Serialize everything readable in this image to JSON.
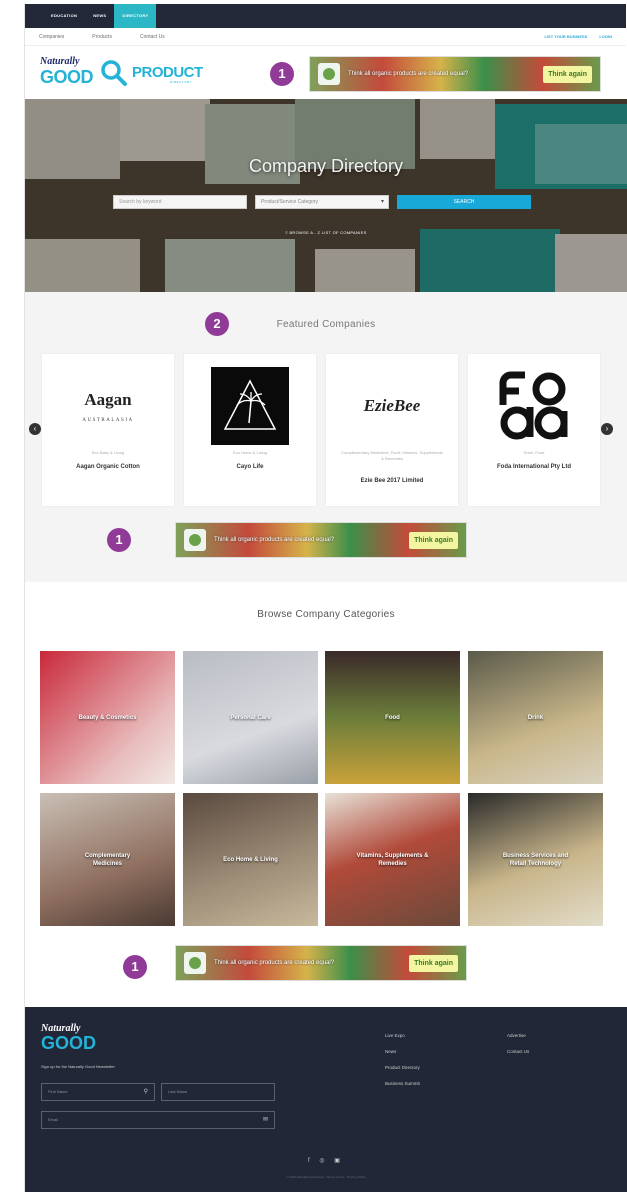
{
  "topbar": {
    "tabs": [
      "EDUCATION",
      "NEWS",
      "DIRECTORY"
    ]
  },
  "subnav": {
    "items": [
      "Companies",
      "Products",
      "Contact Us"
    ],
    "right": [
      "LIST YOUR BUSINESS",
      "LOGIN"
    ]
  },
  "logo": {
    "top": "Naturally",
    "good": "GOOD",
    "product": "PRODUCT",
    "directory": "DIRECTORY"
  },
  "badges": {
    "one": "1",
    "two": "2"
  },
  "ad": {
    "text": "Think all organic products are created equal?",
    "cta": "Think again"
  },
  "hero": {
    "title": "Company Directory",
    "search_placeholder": "Search by keyword",
    "select_value": "Product/Service Category",
    "search_button": "SEARCH",
    "browse_list": "BROWSE A - Z LIST OF COMPANIES"
  },
  "featured": {
    "title": "Featured Companies",
    "cards": [
      {
        "logo": "Aagan",
        "logo_sub": "AUSTRALASIA",
        "category": "Eco Baby & Living",
        "name": "Aagan Organic Cotton"
      },
      {
        "logo": "",
        "logo_sub": "",
        "category": "Eco Home & Living",
        "name": "Cayo Life"
      },
      {
        "logo": "EzieBee",
        "logo_sub": "",
        "category": "Complementary Medicines; Food; Vitamins, Supplements & Remedies",
        "name": "Ezie Bee 2017 Limited"
      },
      {
        "logo": "FODA",
        "logo_sub": "",
        "category": "Drink; Food",
        "name": "Foda International Pty Ltd"
      }
    ]
  },
  "browse": {
    "title": "Browse Company Categories",
    "tiles": [
      "Beauty & Cosmetics",
      "Personal Care",
      "Food",
      "Drink",
      "Complementary Medicines",
      "Eco Home & Living",
      "Vitamins, Supplements & Remedies",
      "Business Services and Retail Technology"
    ]
  },
  "footer": {
    "logo_top": "Naturally",
    "logo_good": "GOOD",
    "signup": "Sign up for the Naturally Good Newsletter",
    "first_name": "First Name",
    "last_name": "Last Name",
    "email": "Email",
    "links_col1": [
      "Live Expo",
      "News",
      "Product Directory",
      "Business Summit"
    ],
    "links_col2": [
      "Advertise",
      "Contact Us"
    ],
    "social": "f ◎ ▣",
    "legal": "© 2018 Naturally Good Expo · Terms of Use · Privacy Policy"
  },
  "colors": {
    "accent": "#2cb7c6",
    "dark": "#232838",
    "badge": "#8f3b97",
    "button": "#19a9d8"
  }
}
